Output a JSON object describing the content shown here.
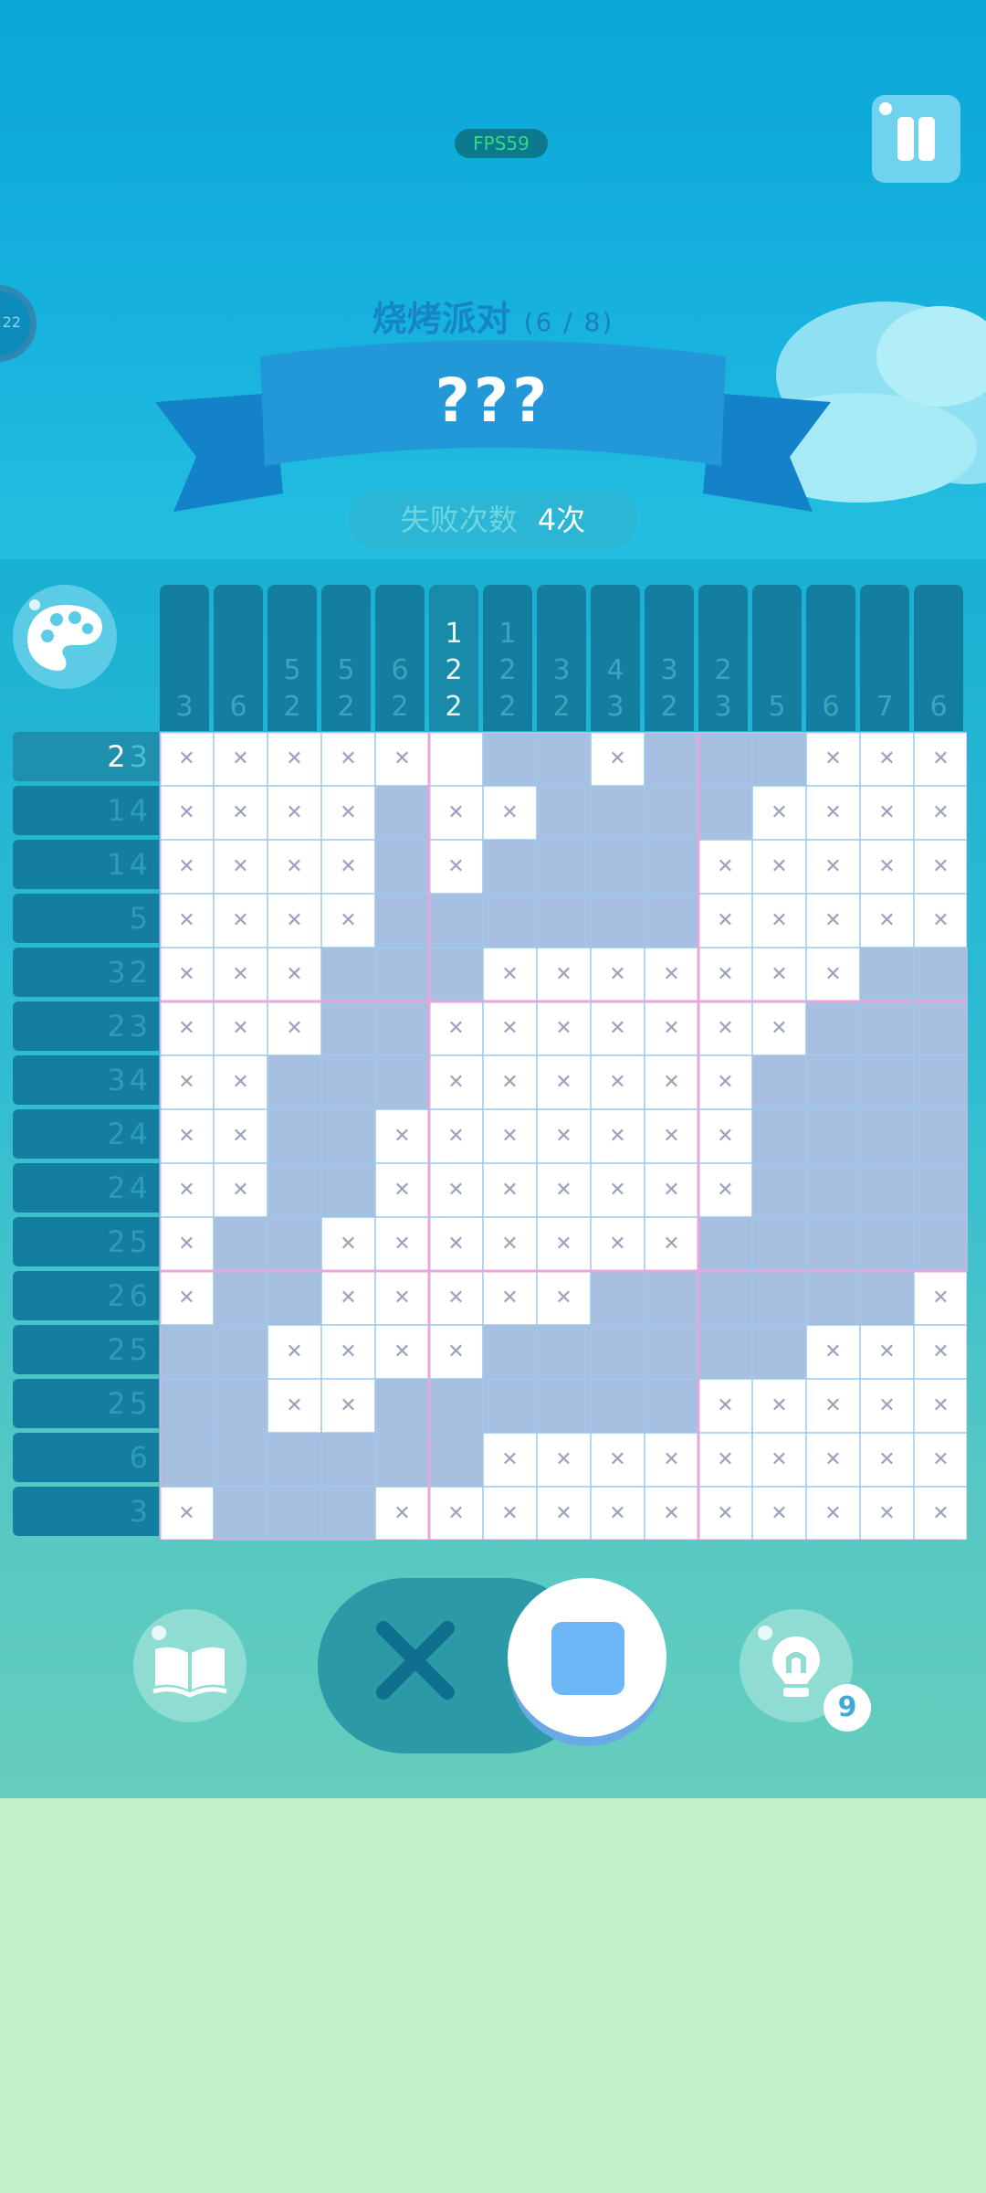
{
  "hud": {
    "fps": "FPS59",
    "side_badge": "22"
  },
  "header": {
    "title": "烧烤派对",
    "progress": "(6 / 8)",
    "puzzle_name": "???",
    "fails_label": "失败次数",
    "fails_value": "4次"
  },
  "colors": {
    "filled": "#a7c0e1",
    "empty": "#ffffff",
    "cross": "#9aa3bb",
    "clue_bg": "#147ea0",
    "clue_text": "#3ba5c0",
    "bottom_bg": "#c4f0c8"
  },
  "column_clues": [
    [
      "3"
    ],
    [
      "6"
    ],
    [
      "5",
      "2"
    ],
    [
      "5",
      "2"
    ],
    [
      "6",
      "2"
    ],
    [
      "1",
      "2",
      "2"
    ],
    [
      "1",
      "2",
      "2"
    ],
    [
      "3",
      "2"
    ],
    [
      "4",
      "3"
    ],
    [
      "3",
      "2"
    ],
    [
      "2",
      "3"
    ],
    [
      "5"
    ],
    [
      "6"
    ],
    [
      "7"
    ],
    [
      "6"
    ]
  ],
  "highlighted_column": 5,
  "row_clues": [
    {
      "nums": [
        "2",
        "3"
      ],
      "highlight": true
    },
    {
      "nums": [
        "1",
        "4"
      ]
    },
    {
      "nums": [
        "1",
        "4"
      ]
    },
    {
      "nums": [
        "5"
      ]
    },
    {
      "nums": [
        "3",
        "2"
      ]
    },
    {
      "nums": [
        "2",
        "3"
      ]
    },
    {
      "nums": [
        "3",
        "4"
      ]
    },
    {
      "nums": [
        "2",
        "4"
      ]
    },
    {
      "nums": [
        "2",
        "4"
      ]
    },
    {
      "nums": [
        "2",
        "5"
      ]
    },
    {
      "nums": [
        "2",
        "6"
      ]
    },
    {
      "nums": [
        "2",
        "5"
      ]
    },
    {
      "nums": [
        "2",
        "5"
      ]
    },
    {
      "nums": [
        "6"
      ]
    },
    {
      "nums": [
        "3"
      ]
    }
  ],
  "board": [
    "xxxxxefxffffxxxxx",
    "xxxxfxxffffxxxx",
    "xxxxfxffffxxxxx",
    "xxxxffffffxxxxx",
    "xxxfffxxxxxxxff",
    "xxxffxxxxxxxfff",
    "xxfffxxxxxxffff",
    "xxffxxxxxxxffff",
    "xxffxxxxxxxffff",
    "xffxxxxxxxfffff",
    "xffxxxxxfffffffx",
    "ffxxxxffffffxxxx",
    "ffxxffffffxxxxx",
    "ffffffxxxxxxxxx",
    "xfffxxxxxxxxxxx"
  ],
  "toolbar": {
    "hints_remaining": "9",
    "mode": "fill"
  }
}
